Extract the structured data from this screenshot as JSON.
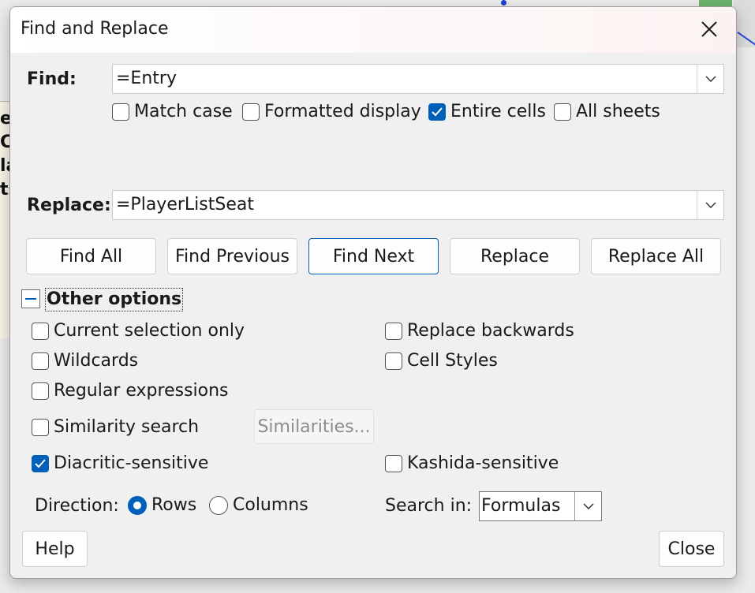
{
  "window": {
    "title": "Find and Replace"
  },
  "background": {
    "fragments": [
      "e",
      "C",
      "la",
      "ts"
    ]
  },
  "find": {
    "label": "Find:",
    "value": "=Entry",
    "options": [
      {
        "label": "Match case",
        "checked": false
      },
      {
        "label": "Formatted display",
        "checked": false
      },
      {
        "label": "Entire cells",
        "checked": true
      },
      {
        "label": "All sheets",
        "checked": false
      }
    ]
  },
  "replace": {
    "label": "Replace:",
    "value": "=PlayerListSeat"
  },
  "buttons": {
    "find_all": "Find All",
    "find_previous": "Find Previous",
    "find_next": "Find Next",
    "replace": "Replace",
    "replace_all": "Replace All"
  },
  "other_options": {
    "label": "Other options",
    "expanded": true,
    "current_selection_only": {
      "label": "Current selection only",
      "checked": false
    },
    "replace_backwards": {
      "label": "Replace backwards",
      "checked": false
    },
    "wildcards": {
      "label": "Wildcards",
      "checked": false
    },
    "cell_styles": {
      "label": "Cell Styles",
      "checked": false
    },
    "regular_expressions": {
      "label": "Regular expressions",
      "checked": false
    },
    "similarity_search": {
      "label": "Similarity search",
      "checked": false
    },
    "similarities_button": "Similarities...",
    "diacritic_sensitive": {
      "label": "Diacritic-sensitive",
      "checked": true
    },
    "kashida_sensitive": {
      "label": "Kashida-sensitive",
      "checked": false
    }
  },
  "direction": {
    "label": "Direction:",
    "rows": "Rows",
    "columns": "Columns",
    "selected": "Rows"
  },
  "search_in": {
    "label": "Search in:",
    "value": "Formulas"
  },
  "footer": {
    "help": "Help",
    "close": "Close"
  },
  "colors": {
    "accent": "#005fb8",
    "dialog_bg": "#f0f0f0"
  },
  "icons": {
    "close": "close-icon",
    "dropdown": "chevron-down-icon",
    "collapse": "minus-icon",
    "check": "checkmark-icon"
  }
}
